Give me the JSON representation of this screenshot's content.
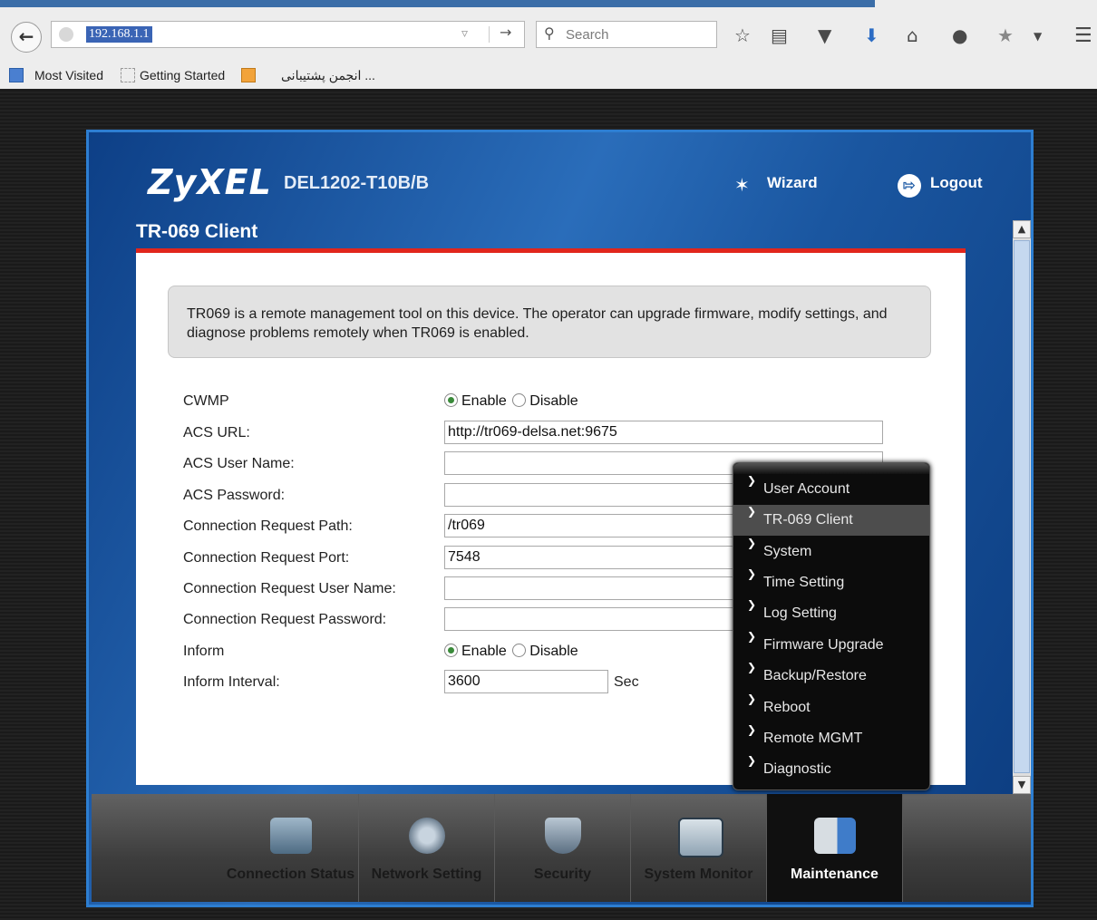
{
  "browser": {
    "url": "192.168.1.1",
    "search_placeholder": "Search",
    "bookmarks": [
      "Most Visited",
      "Getting Started",
      "... انجمن پشتیبانی"
    ]
  },
  "router": {
    "brand": "ZyXEL",
    "model": "DEL1202-T10B/B",
    "wizard_label": "Wizard",
    "logout_label": "Logout",
    "page_title": "TR-069 Client",
    "info_text": "TR069 is a remote management tool on this device. The operator can upgrade firmware, modify settings, and diagnose problems remotely when TR069 is enabled.",
    "form": {
      "cwmp_label": "CWMP",
      "acs_url_label": "ACS URL:",
      "acs_url_value": "http://tr069-delsa.net:9675",
      "acs_user_label": "ACS User Name:",
      "acs_user_value": "",
      "acs_password_label": "ACS Password:",
      "acs_password_value": "",
      "conn_path_label": "Connection Request Path:",
      "conn_path_value": "/tr069",
      "conn_port_label": "Connection Request Port:",
      "conn_port_value": "7548",
      "conn_user_label": "Connection Request User Name:",
      "conn_user_value": "",
      "conn_password_label": "Connection Request Password:",
      "conn_password_value": "",
      "inform_label": "Inform",
      "interval_label": "Inform Interval:",
      "interval_value": "3600",
      "interval_unit": "Sec",
      "enable_label": "Enable",
      "disable_label": "Disable",
      "cwmp_selected": "Enable",
      "inform_selected": "Enable"
    },
    "bottom_nav": [
      "Connection Status",
      "Network Setting",
      "Security",
      "System Monitor",
      "Maintenance"
    ],
    "active_nav": "Maintenance",
    "menu": [
      "User Account",
      "TR-069 Client",
      "System",
      "Time Setting",
      "Log Setting",
      "Firmware Upgrade",
      "Backup/Restore",
      "Reboot",
      "Remote MGMT",
      "Diagnostic"
    ],
    "menu_selected": "TR-069 Client"
  }
}
